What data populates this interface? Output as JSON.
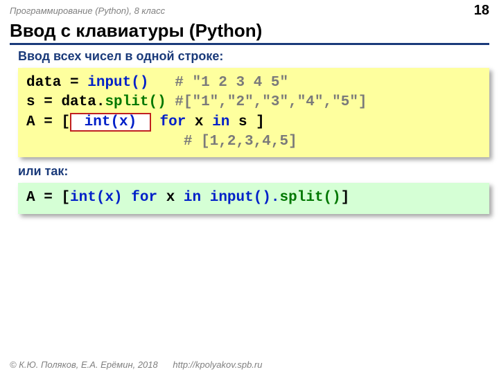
{
  "header": {
    "course": "Программирование (Python), 8 класс",
    "page_number": "18"
  },
  "title": "Ввод с клавиатуры (Python)",
  "section1_label": "Ввод всех чисел в одной строке:",
  "code1": {
    "line1": {
      "a": "data",
      "b": "=",
      "c": "input()   ",
      "d": "# \"1 2 3 4 5\""
    },
    "line2": {
      "a": "s",
      "b": "=",
      "c": "data.",
      "d": "split()",
      "e": " #[\"1\",\"2\",\"3\",\"4\",\"5\"]"
    },
    "line3": {
      "a": "A",
      "b": "=",
      "c": "[",
      "boxed": " int(x) ",
      "d": "for ",
      "e": "x ",
      "f": "in ",
      "g": "s ]"
    },
    "line4": {
      "pad": "                  ",
      "comment": "# [1,2,3,4,5]"
    }
  },
  "section2_label": "или так:",
  "code2": {
    "a": "A",
    "b": "=",
    "c": "[",
    "d": "int(x) ",
    "e": "for ",
    "f": "x ",
    "g": "in ",
    "h": "input().",
    "i": "split()",
    "j": "]"
  },
  "footer": {
    "copyright": "© К.Ю. Поляков, Е.А. Ерёмин, 2018",
    "url": "http://kpolyakov.spb.ru"
  }
}
